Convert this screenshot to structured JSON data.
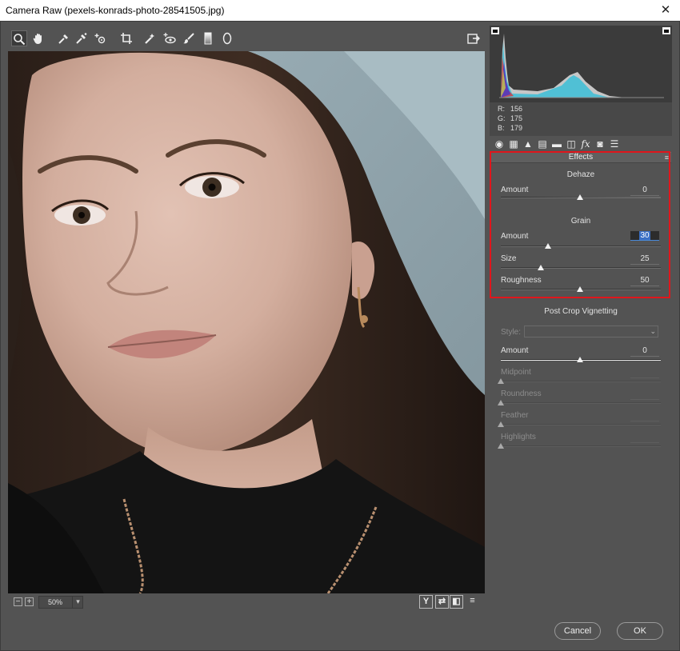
{
  "window": {
    "title": "Camera Raw (pexels-konrads-photo-28541505.jpg)",
    "close_glyph": "✕"
  },
  "toolbar": {
    "tools": [
      {
        "name": "zoom-tool-icon",
        "glyph": "⚲"
      },
      {
        "name": "hand-tool-icon",
        "glyph": "✋"
      },
      {
        "name": "white-balance-tool-icon",
        "glyph": "✎"
      },
      {
        "name": "color-sampler-tool-icon",
        "glyph": "✎"
      },
      {
        "name": "targeted-adjustment-tool-icon",
        "glyph": "⊕"
      },
      {
        "name": "crop-tool-icon",
        "glyph": "⌗"
      },
      {
        "name": "spot-removal-tool-icon",
        "glyph": "✐"
      },
      {
        "name": "red-eye-tool-icon",
        "glyph": "◉"
      },
      {
        "name": "adjustment-brush-icon",
        "glyph": "✐"
      },
      {
        "name": "graduated-filter-icon",
        "glyph": "▮"
      },
      {
        "name": "radial-filter-icon",
        "glyph": "◯"
      }
    ],
    "open_preferences_glyph": "⇱"
  },
  "photo_bar": {
    "zoom_out": "−",
    "zoom_in": "+",
    "zoom_value": "50%",
    "zoom_arrow": "▾",
    "view_buttons": [
      "Y",
      "⇄",
      "◧",
      "≡"
    ]
  },
  "rgb_readout": {
    "r_label": "R:",
    "r": "156",
    "g_label": "G:",
    "g": "175",
    "b_label": "B:",
    "b": "179"
  },
  "panel_tabs": [
    "◉",
    "▦",
    "▲",
    "▤",
    "▬",
    "◫",
    "fx",
    "◙",
    "☰"
  ],
  "effects": {
    "header": "Effects",
    "menu_glyph": "≡",
    "dehaze": {
      "title": "Dehaze",
      "amount_label": "Amount",
      "amount_value": "0",
      "amount_pos": 0.5
    },
    "grain": {
      "title": "Grain",
      "amount_label": "Amount",
      "amount_value": "30",
      "amount_pos": 0.3,
      "size_label": "Size",
      "size_value": "25",
      "size_pos": 0.25,
      "roughness_label": "Roughness",
      "roughness_value": "50",
      "roughness_pos": 0.5
    },
    "vignette": {
      "title": "Post Crop Vignetting",
      "style_label": "Style:",
      "style_arrow": "⌄",
      "amount_label": "Amount",
      "amount_value": "0",
      "amount_pos": 0.5,
      "midpoint_label": "Midpoint",
      "midpoint_pos": 0.0,
      "roundness_label": "Roundness",
      "roundness_pos": 0.0,
      "feather_label": "Feather",
      "feather_pos": 0.0,
      "highlights_label": "Highlights",
      "highlights_pos": 0.0
    }
  },
  "buttons": {
    "cancel": "Cancel",
    "ok": "OK"
  },
  "colors": {
    "panel_bg": "#535353",
    "highlight_box": "#e0161c",
    "accent": "#3a6fc4"
  }
}
